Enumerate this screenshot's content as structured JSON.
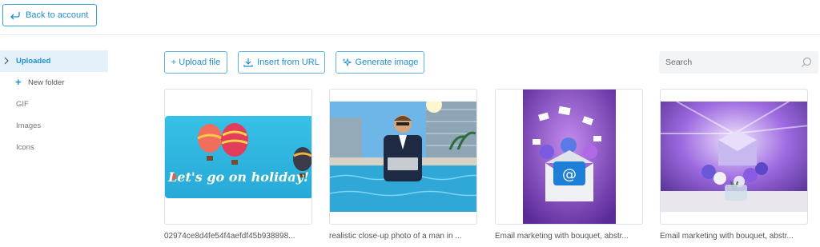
{
  "header": {
    "back_label": "Back to account"
  },
  "sidebar": {
    "items": [
      {
        "label": "Uploaded"
      },
      {
        "label": "New folder"
      },
      {
        "label": "GIF"
      },
      {
        "label": "Images"
      },
      {
        "label": "Icons"
      }
    ]
  },
  "toolbar": {
    "upload_label": "+ Upload file",
    "insert_label": "Insert from URL",
    "generate_label": "Generate image"
  },
  "search": {
    "placeholder": "Search"
  },
  "files": [
    {
      "name": "02974ce8d4fe54f4aefdf45b938898...",
      "image_text": "Let's go on holiday!"
    },
    {
      "name": "realistic close-up photo of a man in ..."
    },
    {
      "name": "Email marketing with bouquet, abstr..."
    },
    {
      "name": "Email marketing with bouquet, abstr..."
    }
  ],
  "colors": {
    "accent": "#1e8fcf",
    "active_bg": "#e4f1fb",
    "border": "#5ab3e2"
  }
}
